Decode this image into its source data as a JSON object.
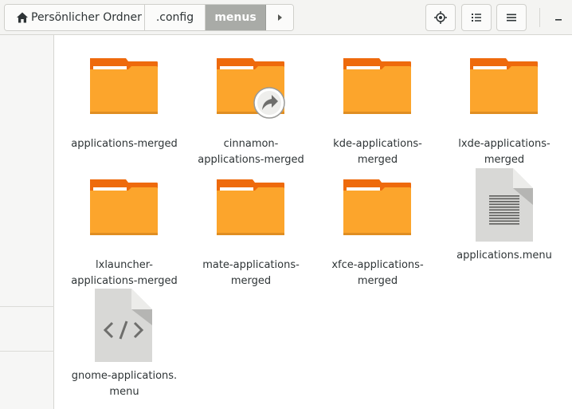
{
  "header": {
    "breadcrumbs": {
      "home": "Persönlicher Ordner",
      "config": ".config",
      "current": "menus"
    }
  },
  "files": [
    {
      "name": "applications-merged",
      "line1": "applications-merged",
      "line2": "",
      "type": "folder"
    },
    {
      "name": "cinnamon-applications-merged",
      "line1": "cinnamon-",
      "line2": "applications-merged",
      "type": "folder-link"
    },
    {
      "name": "kde-applications-merged",
      "line1": "kde-applications-",
      "line2": "merged",
      "type": "folder"
    },
    {
      "name": "lxde-applications-merged",
      "line1": "lxde-applications-",
      "line2": "merged",
      "type": "folder"
    },
    {
      "name": "lxlauncher-applications-merged",
      "line1": "lxlauncher-",
      "line2": "applications-merged",
      "type": "folder"
    },
    {
      "name": "mate-applications-merged",
      "line1": "mate-applications-",
      "line2": "merged",
      "type": "folder"
    },
    {
      "name": "xfce-applications-merged",
      "line1": "xfce-applications-",
      "line2": "merged",
      "type": "folder"
    },
    {
      "name": "applications.menu",
      "line1": "applications.menu",
      "line2": "",
      "type": "text-file"
    },
    {
      "name": "gnome-applications.menu",
      "line1": "gnome-applications.",
      "line2": "menu",
      "type": "code-file"
    }
  ],
  "colors": {
    "folder_body": "#fca52c",
    "folder_tab": "#ee6a0c",
    "active_crumb": "#a9aba7"
  }
}
